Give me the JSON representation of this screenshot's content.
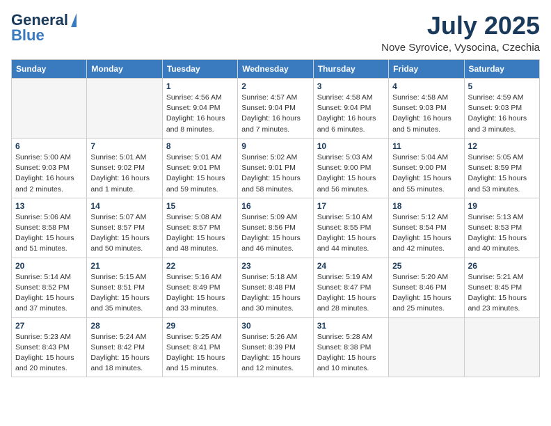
{
  "header": {
    "logo_general": "General",
    "logo_blue": "Blue",
    "month_title": "July 2025",
    "location": "Nove Syrovice, Vysocina, Czechia"
  },
  "calendar": {
    "days_of_week": [
      "Sunday",
      "Monday",
      "Tuesday",
      "Wednesday",
      "Thursday",
      "Friday",
      "Saturday"
    ],
    "weeks": [
      [
        {
          "day": "",
          "info": ""
        },
        {
          "day": "",
          "info": ""
        },
        {
          "day": "1",
          "info": "Sunrise: 4:56 AM\nSunset: 9:04 PM\nDaylight: 16 hours\nand 8 minutes."
        },
        {
          "day": "2",
          "info": "Sunrise: 4:57 AM\nSunset: 9:04 PM\nDaylight: 16 hours\nand 7 minutes."
        },
        {
          "day": "3",
          "info": "Sunrise: 4:58 AM\nSunset: 9:04 PM\nDaylight: 16 hours\nand 6 minutes."
        },
        {
          "day": "4",
          "info": "Sunrise: 4:58 AM\nSunset: 9:03 PM\nDaylight: 16 hours\nand 5 minutes."
        },
        {
          "day": "5",
          "info": "Sunrise: 4:59 AM\nSunset: 9:03 PM\nDaylight: 16 hours\nand 3 minutes."
        }
      ],
      [
        {
          "day": "6",
          "info": "Sunrise: 5:00 AM\nSunset: 9:03 PM\nDaylight: 16 hours\nand 2 minutes."
        },
        {
          "day": "7",
          "info": "Sunrise: 5:01 AM\nSunset: 9:02 PM\nDaylight: 16 hours\nand 1 minute."
        },
        {
          "day": "8",
          "info": "Sunrise: 5:01 AM\nSunset: 9:01 PM\nDaylight: 15 hours\nand 59 minutes."
        },
        {
          "day": "9",
          "info": "Sunrise: 5:02 AM\nSunset: 9:01 PM\nDaylight: 15 hours\nand 58 minutes."
        },
        {
          "day": "10",
          "info": "Sunrise: 5:03 AM\nSunset: 9:00 PM\nDaylight: 15 hours\nand 56 minutes."
        },
        {
          "day": "11",
          "info": "Sunrise: 5:04 AM\nSunset: 9:00 PM\nDaylight: 15 hours\nand 55 minutes."
        },
        {
          "day": "12",
          "info": "Sunrise: 5:05 AM\nSunset: 8:59 PM\nDaylight: 15 hours\nand 53 minutes."
        }
      ],
      [
        {
          "day": "13",
          "info": "Sunrise: 5:06 AM\nSunset: 8:58 PM\nDaylight: 15 hours\nand 51 minutes."
        },
        {
          "day": "14",
          "info": "Sunrise: 5:07 AM\nSunset: 8:57 PM\nDaylight: 15 hours\nand 50 minutes."
        },
        {
          "day": "15",
          "info": "Sunrise: 5:08 AM\nSunset: 8:57 PM\nDaylight: 15 hours\nand 48 minutes."
        },
        {
          "day": "16",
          "info": "Sunrise: 5:09 AM\nSunset: 8:56 PM\nDaylight: 15 hours\nand 46 minutes."
        },
        {
          "day": "17",
          "info": "Sunrise: 5:10 AM\nSunset: 8:55 PM\nDaylight: 15 hours\nand 44 minutes."
        },
        {
          "day": "18",
          "info": "Sunrise: 5:12 AM\nSunset: 8:54 PM\nDaylight: 15 hours\nand 42 minutes."
        },
        {
          "day": "19",
          "info": "Sunrise: 5:13 AM\nSunset: 8:53 PM\nDaylight: 15 hours\nand 40 minutes."
        }
      ],
      [
        {
          "day": "20",
          "info": "Sunrise: 5:14 AM\nSunset: 8:52 PM\nDaylight: 15 hours\nand 37 minutes."
        },
        {
          "day": "21",
          "info": "Sunrise: 5:15 AM\nSunset: 8:51 PM\nDaylight: 15 hours\nand 35 minutes."
        },
        {
          "day": "22",
          "info": "Sunrise: 5:16 AM\nSunset: 8:49 PM\nDaylight: 15 hours\nand 33 minutes."
        },
        {
          "day": "23",
          "info": "Sunrise: 5:18 AM\nSunset: 8:48 PM\nDaylight: 15 hours\nand 30 minutes."
        },
        {
          "day": "24",
          "info": "Sunrise: 5:19 AM\nSunset: 8:47 PM\nDaylight: 15 hours\nand 28 minutes."
        },
        {
          "day": "25",
          "info": "Sunrise: 5:20 AM\nSunset: 8:46 PM\nDaylight: 15 hours\nand 25 minutes."
        },
        {
          "day": "26",
          "info": "Sunrise: 5:21 AM\nSunset: 8:45 PM\nDaylight: 15 hours\nand 23 minutes."
        }
      ],
      [
        {
          "day": "27",
          "info": "Sunrise: 5:23 AM\nSunset: 8:43 PM\nDaylight: 15 hours\nand 20 minutes."
        },
        {
          "day": "28",
          "info": "Sunrise: 5:24 AM\nSunset: 8:42 PM\nDaylight: 15 hours\nand 18 minutes."
        },
        {
          "day": "29",
          "info": "Sunrise: 5:25 AM\nSunset: 8:41 PM\nDaylight: 15 hours\nand 15 minutes."
        },
        {
          "day": "30",
          "info": "Sunrise: 5:26 AM\nSunset: 8:39 PM\nDaylight: 15 hours\nand 12 minutes."
        },
        {
          "day": "31",
          "info": "Sunrise: 5:28 AM\nSunset: 8:38 PM\nDaylight: 15 hours\nand 10 minutes."
        },
        {
          "day": "",
          "info": ""
        },
        {
          "day": "",
          "info": ""
        }
      ]
    ]
  }
}
